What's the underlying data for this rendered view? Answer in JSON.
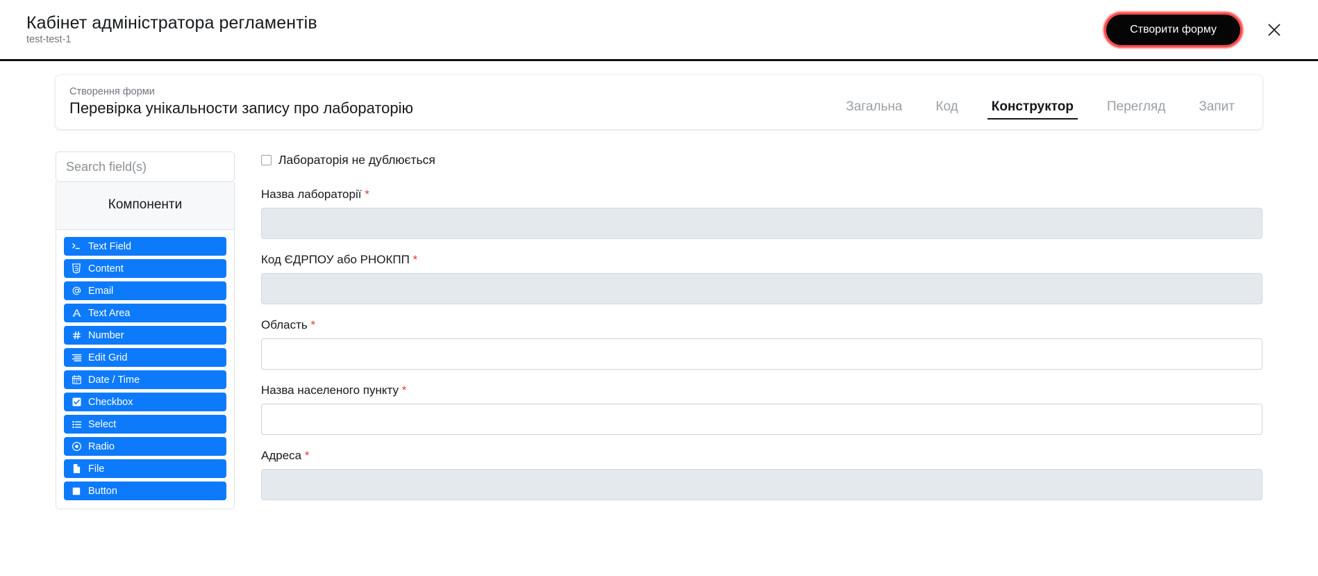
{
  "header": {
    "title": "Кабінет адміністратора регламентів",
    "subtitle": "test-test-1",
    "create_button": "Створити форму",
    "close_icon": "close-icon"
  },
  "form_card": {
    "kicker": "Створення форми",
    "name": "Перевірка унікальности запису про лабораторію",
    "tabs": [
      {
        "label": "Загальна",
        "active": false
      },
      {
        "label": "Код",
        "active": false
      },
      {
        "label": "Конструктор",
        "active": true
      },
      {
        "label": "Перегляд",
        "active": false
      },
      {
        "label": "Запит",
        "active": false
      }
    ]
  },
  "sidebar": {
    "search_placeholder": "Search field(s)",
    "search_value": "",
    "panel_title": "Компоненти",
    "components": [
      {
        "label": "Text Field",
        "icon": "terminal-icon"
      },
      {
        "label": "Content",
        "icon": "html5-icon"
      },
      {
        "label": "Email",
        "icon": "at-icon"
      },
      {
        "label": "Text Area",
        "icon": "letter-a-icon"
      },
      {
        "label": "Number",
        "icon": "hash-icon"
      },
      {
        "label": "Edit Grid",
        "icon": "grid-lines-icon"
      },
      {
        "label": "Date / Time",
        "icon": "calendar-icon"
      },
      {
        "label": "Checkbox",
        "icon": "checkbox-icon"
      },
      {
        "label": "Select",
        "icon": "list-icon"
      },
      {
        "label": "Radio",
        "icon": "radio-icon"
      },
      {
        "label": "File",
        "icon": "file-icon"
      },
      {
        "label": "Button",
        "icon": "square-icon"
      }
    ]
  },
  "form_preview": {
    "checkbox": {
      "label": "Лабораторія не дублюється",
      "checked": false
    },
    "fields": [
      {
        "label": "Назва лабораторії",
        "required": true,
        "value": "",
        "disabled": true
      },
      {
        "label": "Код ЄДРПОУ або РНОКПП",
        "required": true,
        "value": "",
        "disabled": true
      },
      {
        "label": "Область",
        "required": true,
        "value": "",
        "disabled": false
      },
      {
        "label": "Назва населеного пункту",
        "required": true,
        "value": "",
        "disabled": false
      },
      {
        "label": "Адреса",
        "required": true,
        "value": "",
        "disabled": true
      }
    ]
  },
  "colors": {
    "accent_blue": "#0d7afc",
    "required_red": "#e53935",
    "button_black": "#050505",
    "button_glow_red": "#ff4d4d",
    "disabled_field": "#e4e9ed"
  }
}
